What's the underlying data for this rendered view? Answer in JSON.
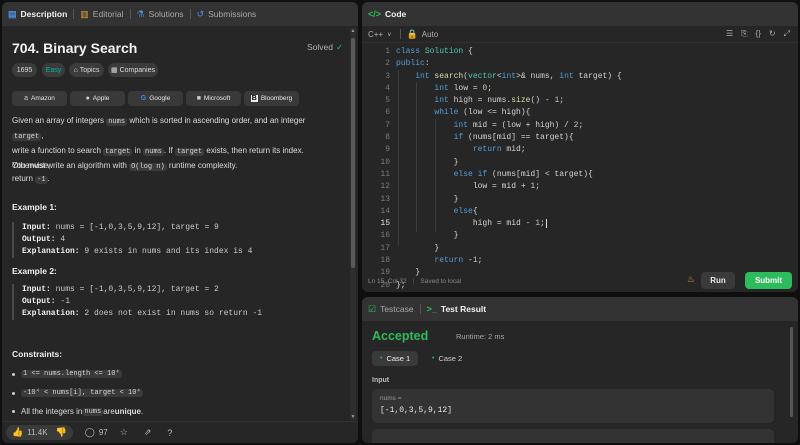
{
  "left_tabs": [
    {
      "label": "Description",
      "icon": "document-icon"
    },
    {
      "label": "Editorial",
      "icon": "book-icon"
    },
    {
      "label": "Solutions",
      "icon": "flask-icon"
    },
    {
      "label": "Submissions",
      "icon": "history-icon"
    }
  ],
  "problem": {
    "title": "704. Binary Search",
    "status": "Solved",
    "badges": {
      "count": "1695",
      "difficulty": "Easy",
      "topics": "Topics",
      "companies": "Companies"
    },
    "companies": [
      "Amazon",
      "Apple",
      "Google",
      "Microsoft",
      "Bloomberg"
    ],
    "desc": {
      "p1a": "Given an array of integers ",
      "c1": "nums",
      "p1b": " which is sorted in ascending order, and an integer ",
      "c2": "target",
      "p1c": ",",
      "p2a": "write a function to search ",
      "c3": "target",
      "p2b": " in ",
      "c4": "nums",
      "p2c": ". If ",
      "c5": "target",
      "p2d": " exists, then return its index. Otherwise,",
      "p3a": "return ",
      "c6": "-1",
      "p3b": ".",
      "p4a": "You must write an algorithm with ",
      "c7": "O(log n)",
      "p4b": " runtime complexity."
    },
    "examples": [
      {
        "heading": "Example 1:",
        "input_label": "Input:",
        "input": " nums = [-1,0,3,5,9,12], target = 9",
        "output_label": "Output:",
        "output": " 4",
        "expl_label": "Explanation:",
        "expl": " 9 exists in nums and its index is 4"
      },
      {
        "heading": "Example 2:",
        "input_label": "Input:",
        "input": " nums = [-1,0,3,5,9,12], target = 2",
        "output_label": "Output:",
        "output": " -1",
        "expl_label": "Explanation:",
        "expl": " 2 does not exist in nums so return -1"
      }
    ],
    "constraints_heading": "Constraints:",
    "constraints": [
      {
        "code": "1 <= nums.length <= 10⁴"
      },
      {
        "code": "-10⁴ < nums[i], target < 10⁴"
      },
      {
        "pre": "All the integers in ",
        "code": "nums",
        "post": " are ",
        "bold": "unique",
        "end": "."
      }
    ]
  },
  "footer": {
    "likes": "11.4K",
    "comments": "97"
  },
  "code_panel": {
    "title": "Code",
    "language": "C++",
    "mode": "Auto",
    "line_numbers": [
      "1",
      "2",
      "3",
      "4",
      "5",
      "6",
      "7",
      "8",
      "9",
      "10",
      "11",
      "12",
      "13",
      "14",
      "15",
      "16",
      "17",
      "18",
      "19",
      "20"
    ],
    "status": "Ln 15, Col 32",
    "saved": "Saved to local",
    "run": "Run",
    "submit": "Submit"
  },
  "result_panel": {
    "tab_testcase": "Testcase",
    "tab_result": "Test Result",
    "verdict": "Accepted",
    "runtime": "Runtime: 2 ms",
    "cases": [
      "Case 1",
      "Case 2"
    ],
    "input_label": "Input",
    "var_name": "nums =",
    "var_value": "[-1,0,3,5,9,12]"
  },
  "colors": {
    "accent_green": "#2cbb5d",
    "easy": "#00b8a3",
    "panel": "#262626",
    "header": "#333333"
  }
}
